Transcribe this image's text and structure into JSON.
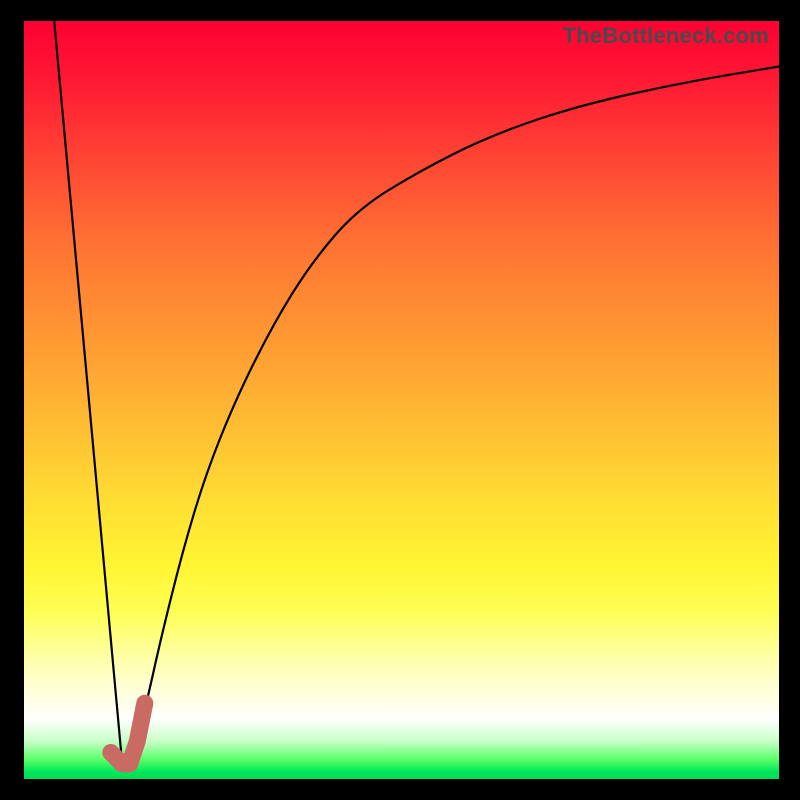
{
  "watermark": "TheBottleneck.com",
  "chart_data": {
    "type": "line",
    "xlim": [
      0,
      100
    ],
    "ylim": [
      0,
      100
    ],
    "title": "",
    "xlabel": "",
    "ylabel": "",
    "grid": false,
    "series": [
      {
        "name": "left-descend",
        "x": [
          4,
          13
        ],
        "values": [
          100,
          2
        ]
      },
      {
        "name": "right-curve",
        "x": [
          14,
          16,
          18,
          21,
          24,
          28,
          33,
          38,
          44,
          52,
          62,
          74,
          88,
          100
        ],
        "values": [
          2,
          9,
          18,
          30,
          40,
          50,
          60,
          68,
          75,
          80,
          85,
          89,
          92,
          94
        ]
      }
    ],
    "highlight": {
      "name": "hook",
      "color": "#c96a63",
      "x": [
        11.5,
        13,
        14,
        15,
        16
      ],
      "values": [
        3.5,
        2,
        2,
        5,
        10
      ]
    },
    "background_gradient": {
      "stops": [
        {
          "pos": 0,
          "color": "#ff0033"
        },
        {
          "pos": 50,
          "color": "#ffcc33"
        },
        {
          "pos": 85,
          "color": "#ffff99"
        },
        {
          "pos": 100,
          "color": "#00dd55"
        }
      ]
    }
  }
}
